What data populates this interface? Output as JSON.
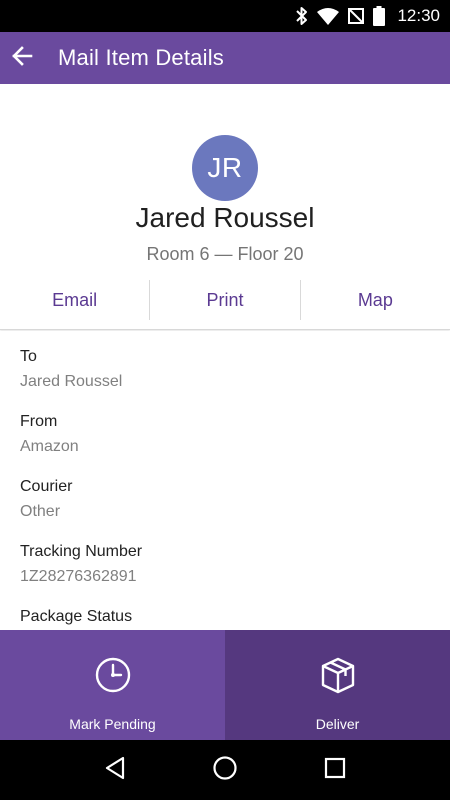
{
  "status_bar": {
    "time": "12:30",
    "icons": [
      "bluetooth-icon",
      "wifi-icon",
      "no-sim-icon",
      "battery-icon"
    ]
  },
  "app_bar": {
    "title": "Mail Item Details",
    "back_icon": "arrow-back-icon"
  },
  "recipient": {
    "initials": "JR",
    "name": "Jared Roussel",
    "location": "Room 6 — Floor 20",
    "avatar_color": "#6b78be"
  },
  "actions": {
    "email": "Email",
    "print": "Print",
    "map": "Map"
  },
  "details": {
    "to": {
      "label": "To",
      "value": "Jared Roussel"
    },
    "from": {
      "label": "From",
      "value": "Amazon"
    },
    "courier": {
      "label": "Courier",
      "value": "Other"
    },
    "tracking": {
      "label": "Tracking Number",
      "value": "1Z28276362891"
    },
    "status": {
      "label": "Package Status"
    }
  },
  "bottom_actions": {
    "mark_pending": {
      "label": "Mark Pending",
      "icon": "clock-icon"
    },
    "deliver": {
      "label": "Deliver",
      "icon": "package-box-icon"
    }
  },
  "nav": {
    "icons": [
      "back-triangle-icon",
      "home-circle-icon",
      "recents-square-icon"
    ]
  },
  "colors": {
    "primary": "#6a4a9e",
    "primary_dark": "#55387f",
    "accent_text": "#5b3a92"
  }
}
